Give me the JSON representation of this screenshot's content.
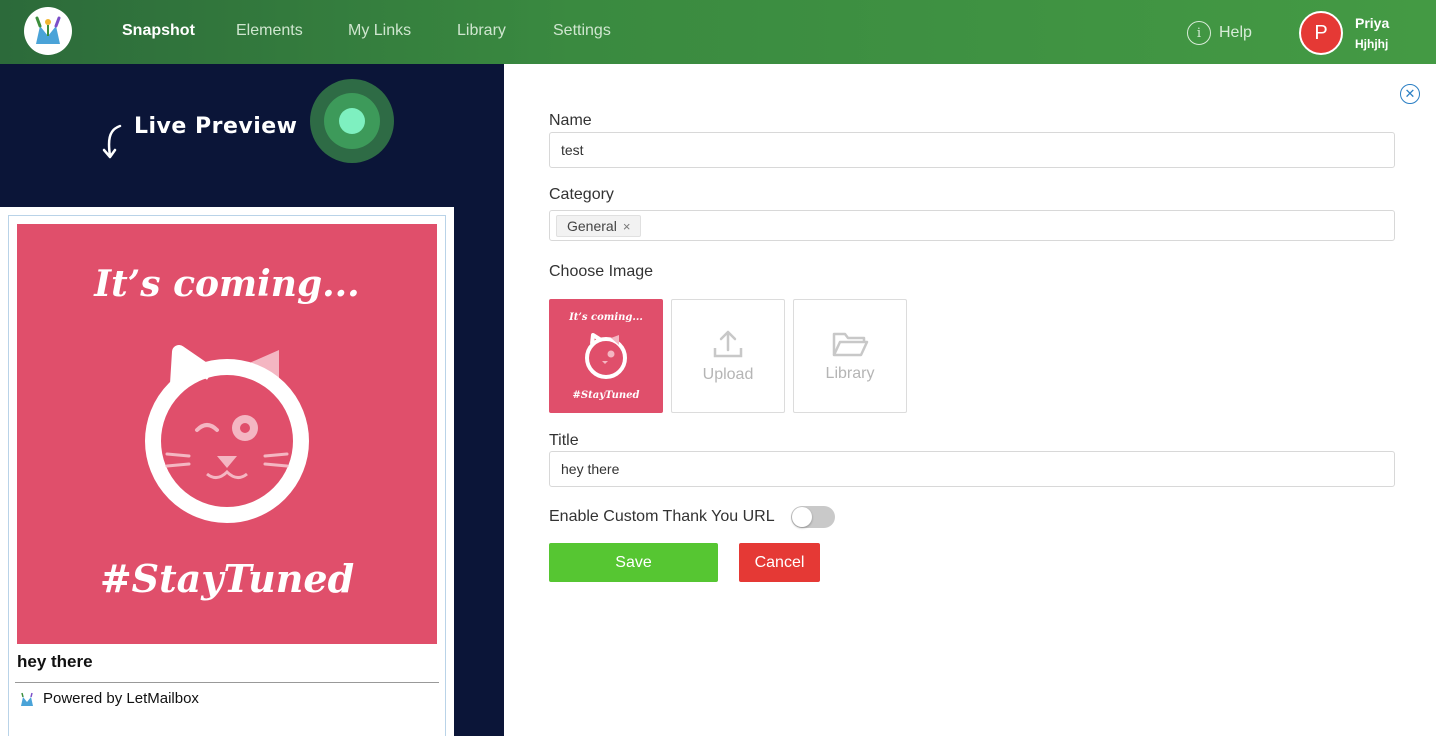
{
  "nav": {
    "items": [
      {
        "label": "Snapshot",
        "active": true
      },
      {
        "label": "Elements",
        "active": false
      },
      {
        "label": "My Links",
        "active": false
      },
      {
        "label": "Library",
        "active": false
      },
      {
        "label": "Settings",
        "active": false
      }
    ],
    "help_label": "Help",
    "user": {
      "initial": "P",
      "name": "Priya",
      "subtitle": "Hjhjhj"
    }
  },
  "preview": {
    "heading": "Live Preview",
    "image_text_top": "It’s coming...",
    "image_text_bottom": "#StayTuned",
    "title": "hey there",
    "powered_by": "Powered by LetMailbox"
  },
  "form": {
    "name_label": "Name",
    "name_value": "test",
    "category_label": "Category",
    "category_tags": [
      "General"
    ],
    "choose_image_label": "Choose Image",
    "upload_label": "Upload",
    "library_label": "Library",
    "thumb_text_top": "It’s coming...",
    "thumb_text_bottom": "#StayTuned",
    "title_label": "Title",
    "title_value": "hey there",
    "thank_you_label": "Enable Custom Thank You URL",
    "thank_you_enabled": false,
    "save_label": "Save",
    "cancel_label": "Cancel"
  },
  "colors": {
    "header_green": "#3a8a40",
    "preview_bg": "#0b1538",
    "image_pink": "#e04f6b",
    "save_green": "#56c632",
    "cancel_red": "#e53935"
  }
}
